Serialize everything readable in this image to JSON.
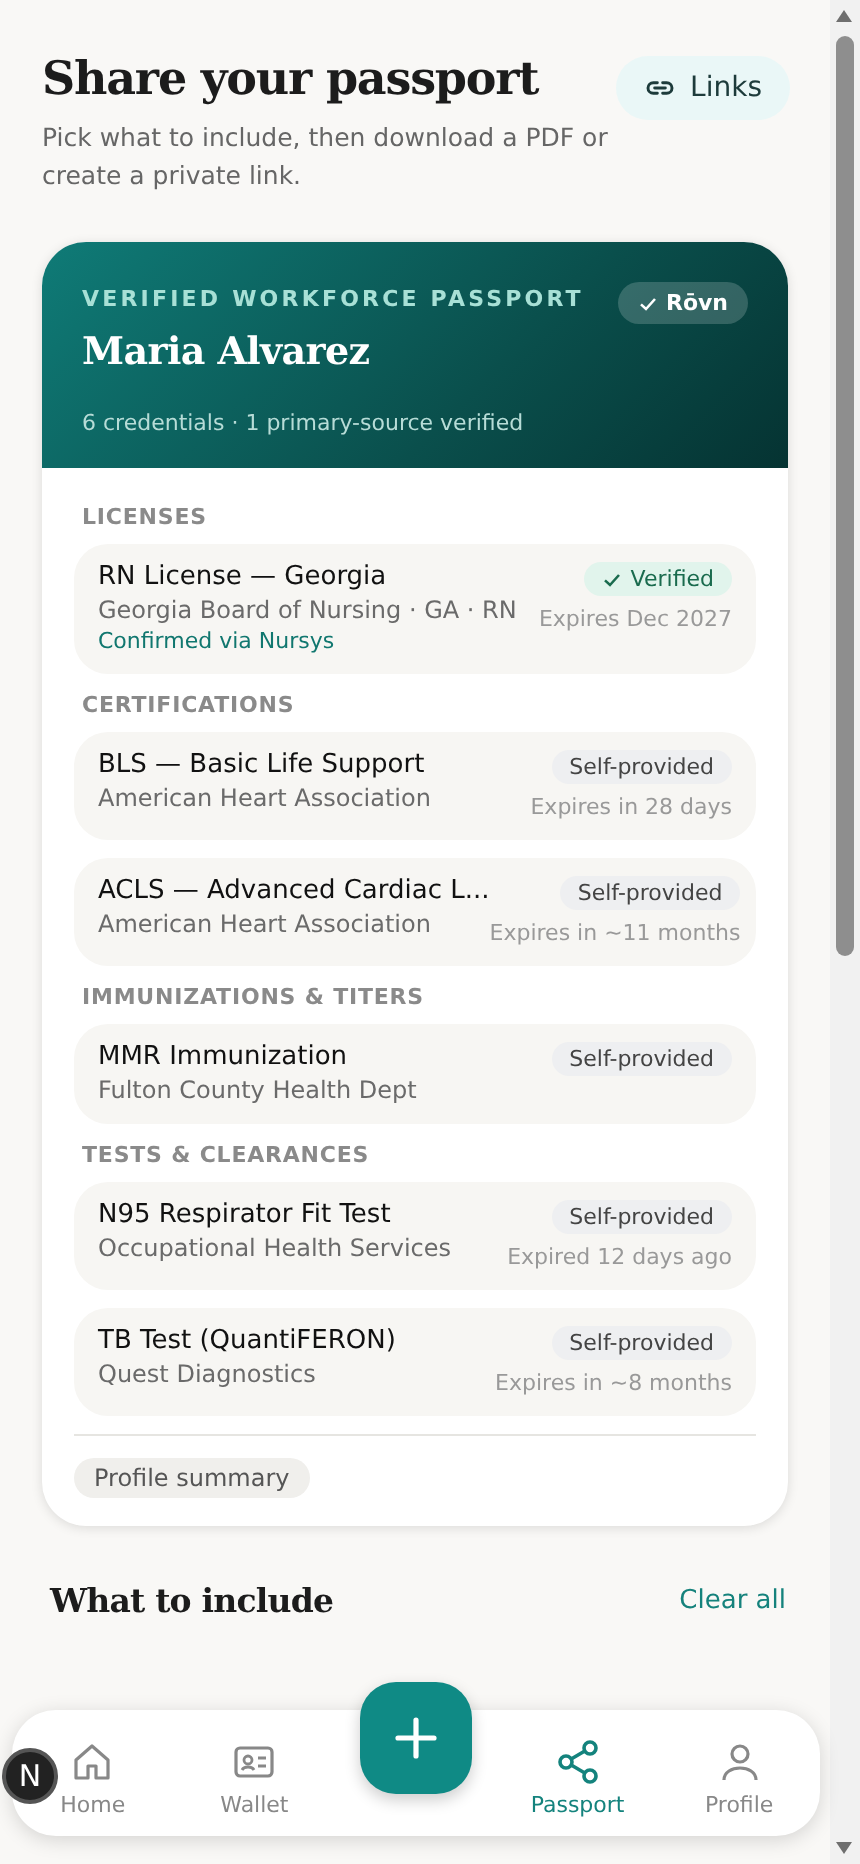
{
  "header": {
    "title": "Share your passport",
    "subtitle": "Pick what to include, then download a PDF or create a private link.",
    "links_button": "Links"
  },
  "passport": {
    "eyebrow": "VERIFIED WORKFORCE PASSPORT",
    "name": "Maria Alvarez",
    "summary": "6 credentials · 1 primary-source verified",
    "brand_badge": "Rōvn"
  },
  "sections": [
    {
      "title": "LICENSES",
      "items": [
        {
          "name": "RN License — Georgia",
          "issuer": "Georgia Board of Nursing · GA · RN",
          "note": "Confirmed via Nursys",
          "status": {
            "kind": "verified",
            "label": "Verified"
          },
          "expiry": "Expires Dec 2027"
        }
      ]
    },
    {
      "title": "CERTIFICATIONS",
      "items": [
        {
          "name": "BLS — Basic Life Support",
          "issuer": "American Heart Association",
          "status": {
            "kind": "self",
            "label": "Self-provided"
          },
          "expiry": "Expires in 28 days"
        },
        {
          "name": "ACLS — Advanced Cardiac L...",
          "issuer": "American Heart Association",
          "status": {
            "kind": "self",
            "label": "Self-provided"
          },
          "expiry": "Expires in ~11 months"
        }
      ]
    },
    {
      "title": "IMMUNIZATIONS & TITERS",
      "items": [
        {
          "name": "MMR Immunization",
          "issuer": "Fulton County Health Dept",
          "status": {
            "kind": "self",
            "label": "Self-provided"
          }
        }
      ]
    },
    {
      "title": "TESTS & CLEARANCES",
      "items": [
        {
          "name": "N95 Respirator Fit Test",
          "issuer": "Occupational Health Services",
          "status": {
            "kind": "self",
            "label": "Self-provided"
          },
          "expiry": "Expired 12 days ago"
        },
        {
          "name": "TB Test (QuantiFERON)",
          "issuer": "Quest Diagnostics",
          "status": {
            "kind": "self",
            "label": "Self-provided"
          },
          "expiry": "Expires in ~8 months"
        }
      ]
    }
  ],
  "extras": [
    "Profile summary"
  ],
  "include": {
    "title": "What to include",
    "action": "Clear all"
  },
  "nav": [
    {
      "label": "Home",
      "kind": "home",
      "selected": false
    },
    {
      "label": "Wallet",
      "kind": "wallet",
      "selected": false
    },
    {
      "label": "Passport",
      "kind": "share",
      "selected": true
    },
    {
      "label": "Profile",
      "kind": "profile",
      "selected": false
    }
  ],
  "dev_badge": "N"
}
